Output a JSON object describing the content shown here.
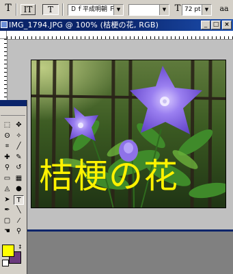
{
  "options_bar": {
    "text_tool_label": "T",
    "orient_label": "IT",
    "warp_label": "T",
    "font_family": "Ｄｆ平成明朝 ＰＲ",
    "font_style": "",
    "size_icon_label": "T",
    "font_size": "72 pt",
    "aa_label": "aa"
  },
  "document": {
    "title": "IMG_1794.JPG @ 100% (桔梗の花, RGB)",
    "minimize_label": "_",
    "maximize_label": "□",
    "close_label": "×",
    "layer_text": "桔梗の花",
    "text_color": "#fff200",
    "photo_description_colors": {
      "petal": "#7d5ce0",
      "leaf": "#3f8a2a",
      "fence": "#3a3326"
    }
  },
  "toolbox": {
    "tools": [
      {
        "name": "marquee-tool",
        "glyph": "⬚"
      },
      {
        "name": "move-tool",
        "glyph": "✥"
      },
      {
        "name": "lasso-tool",
        "glyph": "ʘ"
      },
      {
        "name": "magic-wand-tool",
        "glyph": "✧"
      },
      {
        "name": "crop-tool",
        "glyph": "⌗"
      },
      {
        "name": "slice-tool",
        "glyph": "╱"
      },
      {
        "name": "healing-tool",
        "glyph": "✚"
      },
      {
        "name": "brush-tool",
        "glyph": "✎"
      },
      {
        "name": "stamp-tool",
        "glyph": "⚲"
      },
      {
        "name": "history-brush-tool",
        "glyph": "↺"
      },
      {
        "name": "eraser-tool",
        "glyph": "▭"
      },
      {
        "name": "gradient-tool",
        "glyph": "▦"
      },
      {
        "name": "blur-tool",
        "glyph": "◬"
      },
      {
        "name": "dodge-tool",
        "glyph": "●"
      },
      {
        "name": "path-select-tool",
        "glyph": "➤"
      },
      {
        "name": "type-tool",
        "glyph": "T"
      },
      {
        "name": "pen-tool",
        "glyph": "✒"
      },
      {
        "name": "shape-tool",
        "glyph": "╲"
      },
      {
        "name": "notes-tool",
        "glyph": "▢"
      },
      {
        "name": "eyedropper-tool",
        "glyph": "⁄"
      },
      {
        "name": "hand-tool",
        "glyph": "☚"
      },
      {
        "name": "zoom-tool",
        "glyph": "⚲"
      }
    ],
    "foreground_color": "#ffff00",
    "background_color": "#6b3a7d",
    "swap_glyph": "↕"
  }
}
